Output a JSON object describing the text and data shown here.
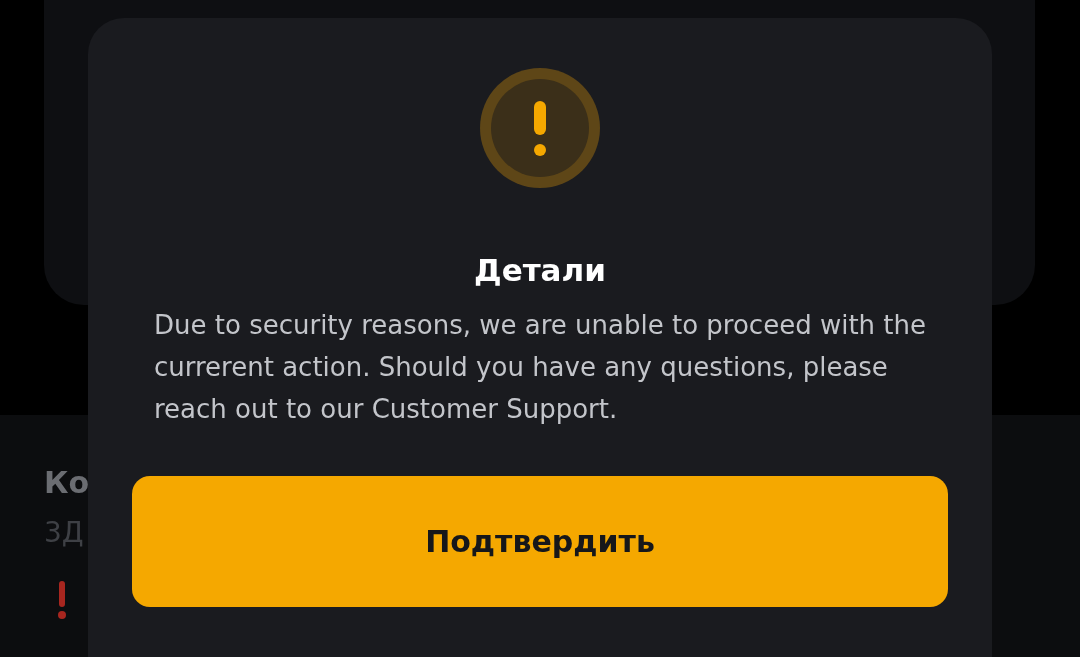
{
  "background": {
    "section_title": "Ко",
    "section_subtitle": "3Д"
  },
  "dialog": {
    "title": "Детали",
    "message": "Due to security reasons, we are unable to proceed with the currerent action. Should you have any questions, please reach out to our Customer Support.",
    "confirm_button": "Подтвердить"
  }
}
